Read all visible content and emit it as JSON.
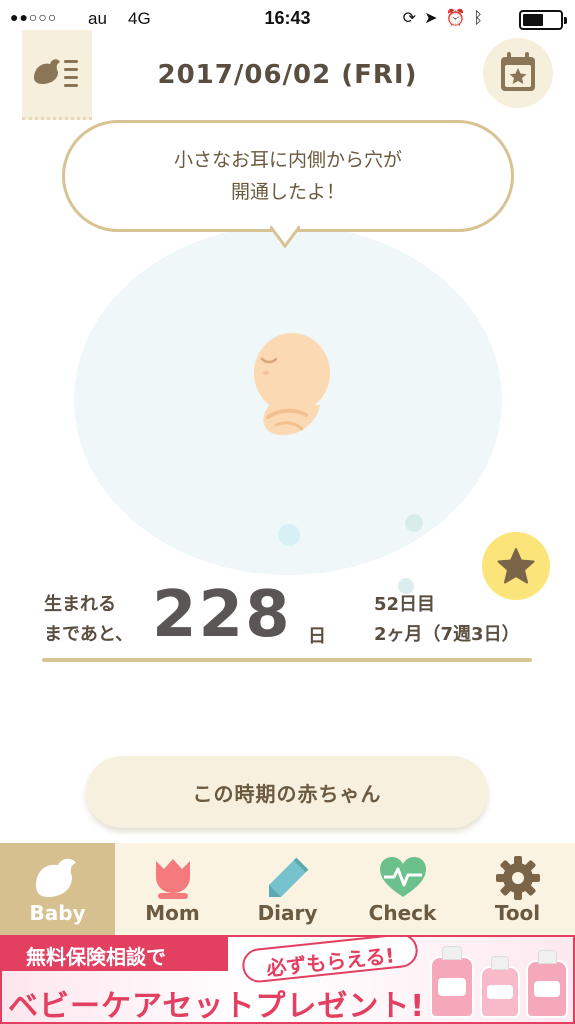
{
  "status_bar": {
    "signal": "●●○○○",
    "carrier": "au",
    "network": "4G",
    "time": "16:43",
    "icons": [
      "rotation-lock-icon",
      "location-icon",
      "alarm-icon",
      "bluetooth-icon"
    ],
    "battery_level": 0.55
  },
  "header": {
    "date": "2017/06/02 (FRI)",
    "menu_icon": "bird-list-icon",
    "calendar_icon": "calendar-star-icon"
  },
  "message": "小さなお耳に内側から穴が\n開通したよ！",
  "countdown": {
    "label": "生まれる\nまであと、",
    "days_left": "228",
    "unit": "日",
    "days_elapsed": "52日目",
    "months_weeks": "2ヶ月（7週3日）"
  },
  "actions": {
    "period_button": "この時期の赤ちゃん"
  },
  "tabs": [
    {
      "label": "Baby",
      "icon": "bird-icon",
      "active": true
    },
    {
      "label": "Mom",
      "icon": "tulip-icon",
      "active": false
    },
    {
      "label": "Diary",
      "icon": "pencil-icon",
      "active": false
    },
    {
      "label": "Check",
      "icon": "heart-pulse-icon",
      "active": false
    },
    {
      "label": "Tool",
      "icon": "gear-icon",
      "active": false
    }
  ],
  "ad": {
    "top": "無料保険相談で",
    "badge": "必ずもらえる!",
    "bottom": "ベビーケアセットプレゼント!"
  },
  "colors": {
    "accent": "#d7c394",
    "tab_active": "#d6c08f",
    "text": "#6b5a40",
    "star": "#fbe57a",
    "ad_red": "#e23f61"
  }
}
